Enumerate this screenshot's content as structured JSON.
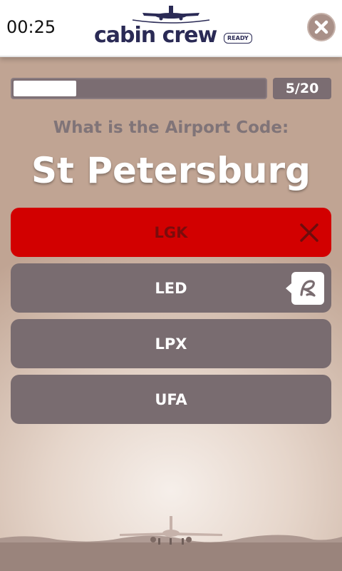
{
  "header": {
    "timer": "00:25",
    "logo_text": "cabin crew",
    "logo_badge": "READY",
    "close_icon": "close-x-icon"
  },
  "progress": {
    "current": 5,
    "total": 20,
    "label": "5/20",
    "fill_fraction": 0.25
  },
  "quiz": {
    "question": "What is the Airport Code:",
    "city": "St Petersburg",
    "answers": [
      {
        "label": "LGK",
        "state": "wrong",
        "icon": "x-mark-icon"
      },
      {
        "label": "LED",
        "state": "correct",
        "icon": "signature-hint-icon"
      },
      {
        "label": "LPX",
        "state": "neutral"
      },
      {
        "label": "UFA",
        "state": "neutral"
      }
    ]
  },
  "colors": {
    "wrong": "#d20000",
    "answer_bg": "#796c70",
    "title_color": "#2a2a55"
  }
}
